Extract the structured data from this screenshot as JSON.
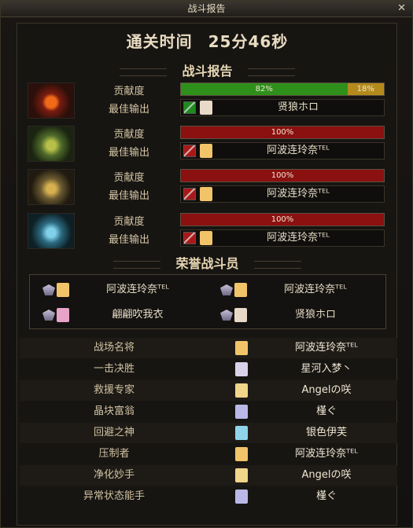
{
  "window": {
    "title": "战斗报告",
    "close_glyph": "✕"
  },
  "clear_time": {
    "label": "通关时间",
    "value": "25分46秒"
  },
  "battle_report": {
    "heading": "战斗报告",
    "contribution_label": "贡献度",
    "best_output_label": "最佳输出",
    "bosses": [
      {
        "boss_icon": "red-flame-mask-icon",
        "segments": [
          {
            "text": "82%",
            "value": 82,
            "color": "#2f8f1b"
          },
          {
            "text": "18%",
            "value": 18,
            "color": "#b48a1c"
          }
        ],
        "best_name": "贤狼ホロ",
        "weapon_color": "#1e8a1e",
        "portrait_color": "#e8d9c8"
      },
      {
        "boss_icon": "green-horned-mask-icon",
        "segments": [
          {
            "text": "100%",
            "value": 100,
            "color": "#8b1010"
          }
        ],
        "best_name": "阿波连玲奈ᵀᴱᴸ",
        "weapon_color": "#a81818",
        "portrait_color": "#f2c46a"
      },
      {
        "boss_icon": "gold-horned-mask-icon",
        "segments": [
          {
            "text": "100%",
            "value": 100,
            "color": "#8b1010"
          }
        ],
        "best_name": "阿波连玲奈ᵀᴱᴸ",
        "weapon_color": "#a81818",
        "portrait_color": "#f2c46a"
      },
      {
        "boss_icon": "blue-horned-mask-icon",
        "segments": [
          {
            "text": "100%",
            "value": 100,
            "color": "#8b1010"
          }
        ],
        "best_name": "阿波连玲奈ᵀᴱᴸ",
        "weapon_color": "#a81818",
        "portrait_color": "#f2c46a"
      }
    ]
  },
  "honor": {
    "heading": "荣誉战斗员",
    "members": [
      {
        "name": "阿波连玲奈ᵀᴱᴸ",
        "portrait_color": "#f2c46a"
      },
      {
        "name": "阿波连玲奈ᵀᴱᴸ",
        "portrait_color": "#f2c46a"
      },
      {
        "name": "翩翩吹我衣",
        "portrait_color": "#e7a3c8"
      },
      {
        "name": "贤狼ホロ",
        "portrait_color": "#e8d9c8"
      }
    ]
  },
  "awards": [
    {
      "title": "战场名将",
      "name": "阿波连玲奈ᵀᴱᴸ",
      "portrait_color": "#f2c46a"
    },
    {
      "title": "一击决胜",
      "name": "星河入梦丶",
      "portrait_color": "#d9d2e8"
    },
    {
      "title": "救援专家",
      "name": "Angelの咲",
      "portrait_color": "#f0d58a"
    },
    {
      "title": "晶块富翁",
      "name": "槿ぐ",
      "portrait_color": "#b9b8e6"
    },
    {
      "title": "回避之神",
      "name": "银色伊芙",
      "portrait_color": "#8fd3e8"
    },
    {
      "title": "压制者",
      "name": "阿波连玲奈ᵀᴱᴸ",
      "portrait_color": "#f2c46a"
    },
    {
      "title": "净化妙手",
      "name": "Angelの咲",
      "portrait_color": "#f0d58a"
    },
    {
      "title": "异常状态能手",
      "name": "槿ぐ",
      "portrait_color": "#b9b8e6"
    }
  ]
}
